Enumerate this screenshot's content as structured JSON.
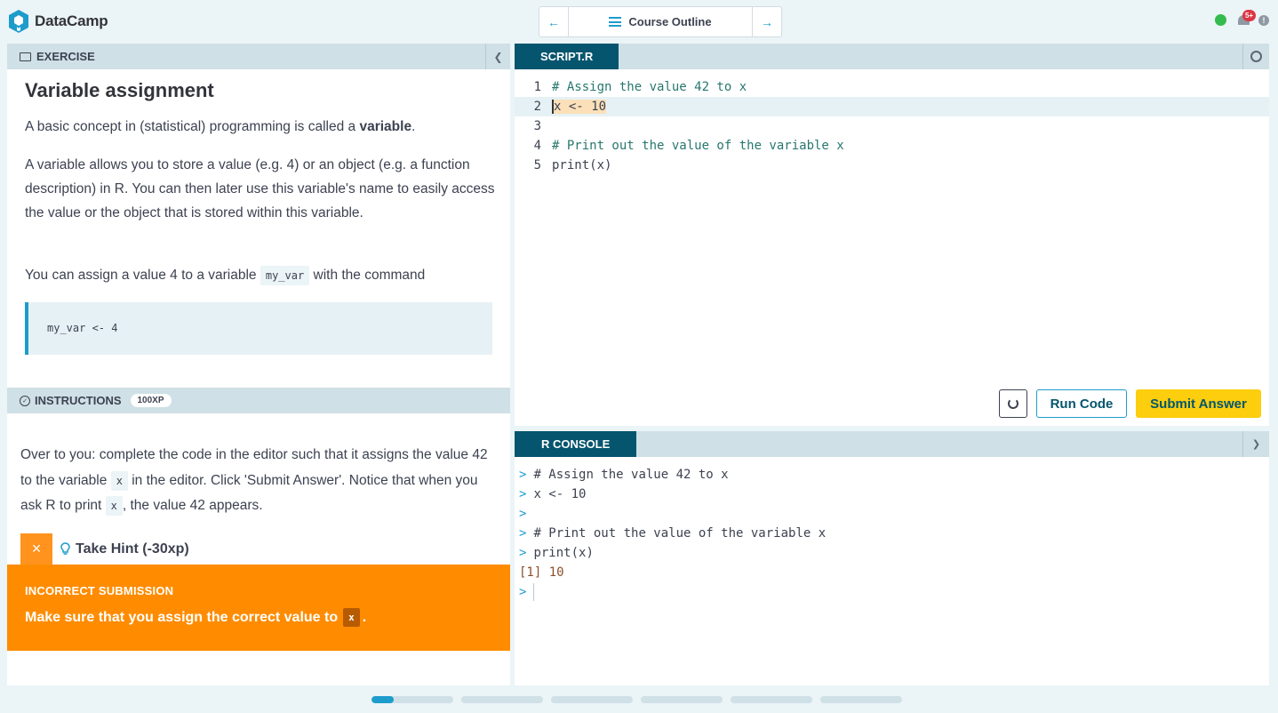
{
  "brand": {
    "name": "DataCamp"
  },
  "nav": {
    "prev_icon": "arrow-left",
    "next_icon": "arrow-right",
    "outline_label": "Course Outline"
  },
  "status": {
    "notification_badge": "5+",
    "info_glyph": "!",
    "online_color": "#33bb4f"
  },
  "exercise": {
    "header": "EXERCISE",
    "title": "Variable assignment",
    "p1_before": "A basic concept in (statistical) programming is called a ",
    "p1_bold": "variable",
    "p1_after": ".",
    "p2": "A variable allows you to store a value (e.g. 4) or an object (e.g. a function description) in R. You can then later use this variable's name to easily access the value or the object that is stored within this variable.",
    "p3_before": "You can assign a value 4 to a variable ",
    "p3_code": "my_var",
    "p3_after": " with the command",
    "code_block": "my_var <- 4"
  },
  "instructions": {
    "header": "INSTRUCTIONS",
    "xp": "100XP",
    "t1": "Over to you: complete the code in the editor such that it assigns the value 42 to the variable ",
    "code1": "x",
    "t2": " in the editor. Click 'Submit Answer'. Notice that when you ask R to print ",
    "code2": "x",
    "t3": ", the value 42 appears.",
    "hint_close": "×",
    "hint_label": "Take Hint (-30xp)"
  },
  "feedback": {
    "title": "INCORRECT SUBMISSION",
    "msg_before": "Make sure that you assign the correct value to ",
    "msg_code": "x",
    "msg_after": ".",
    "color": "#ff8c00"
  },
  "editor": {
    "tab": "SCRIPT.R",
    "lines": [
      {
        "n": "1",
        "text": "# Assign the value 42 to x"
      },
      {
        "n": "2",
        "code_pre": "x",
        "code_hl": " <- 10"
      },
      {
        "n": "3",
        "text": ""
      },
      {
        "n": "4",
        "text": "# Print out the value of the variable x"
      },
      {
        "n": "5",
        "text": "print(x)"
      }
    ],
    "run_label": "Run Code",
    "submit_label": "Submit Answer"
  },
  "console": {
    "tab": "R CONSOLE",
    "prompt": ">",
    "lines": [
      "# Assign the value 42 to x",
      "x <- 10",
      "",
      "# Print out the value of the variable x",
      "print(x)"
    ],
    "output": "[1] 10"
  },
  "progress": {
    "segments": 6,
    "current_segment_fill": 0.27
  }
}
